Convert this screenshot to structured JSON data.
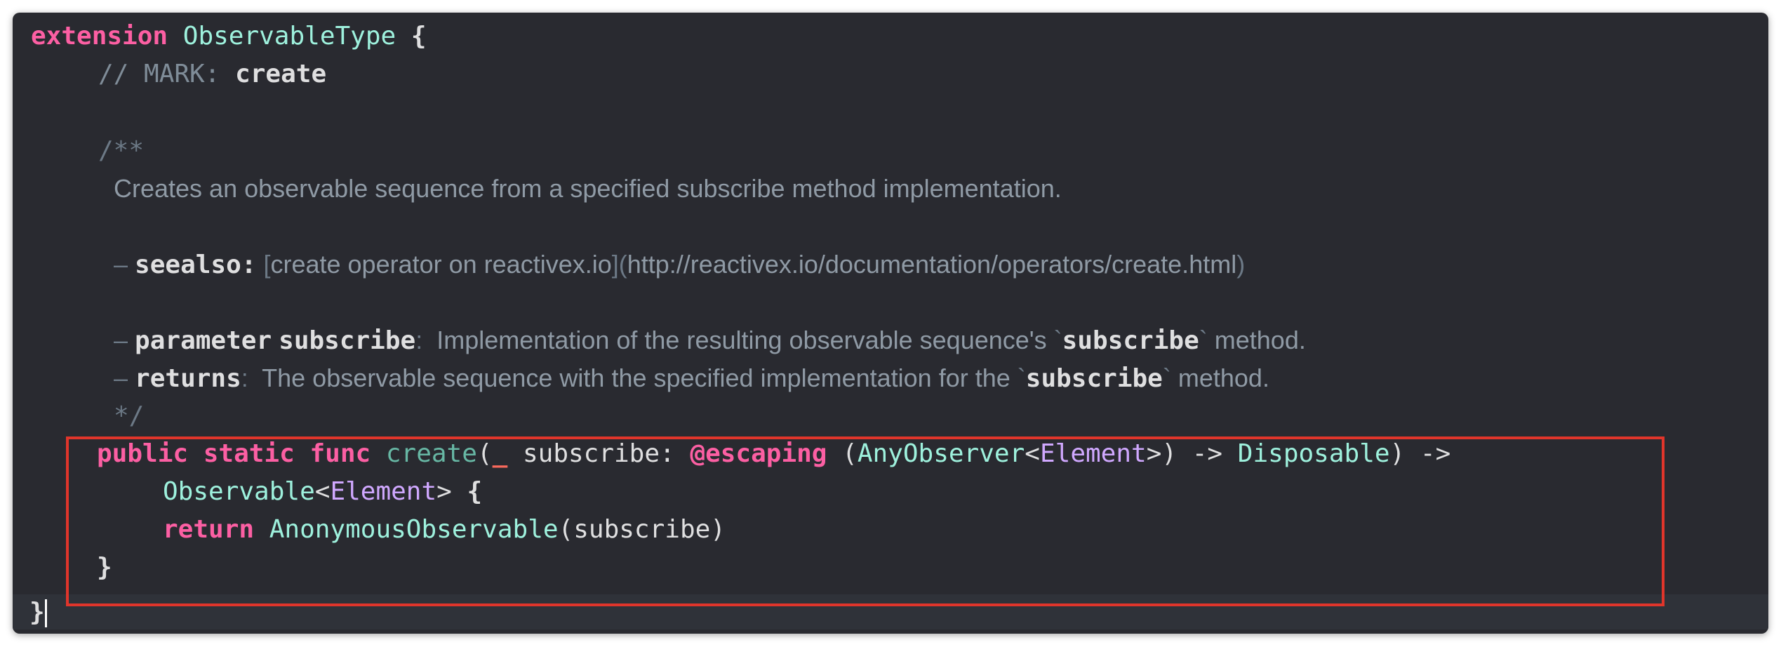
{
  "code": {
    "line1": {
      "keyword": "extension",
      "type": "ObservableType",
      "brace": "{"
    },
    "line2": {
      "prefix": "// MARK: ",
      "label": "create"
    },
    "line4": {
      "text": "/**"
    },
    "line5": {
      "text": "Creates an observable sequence from a specified subscribe method implementation."
    },
    "line7": {
      "dash": "–",
      "tag": "seealso:",
      "link_open": "[",
      "link_text": "create operator on reactivex.io",
      "link_close": "]",
      "url_open": "(",
      "url": "http://reactivex.io/documentation/operators/create.html",
      "url_close": ")"
    },
    "line9": {
      "dash": "–",
      "tag": "parameter",
      "param": "subscribe",
      "colon": ":",
      "text1": "Implementation of the resulting observable sequence's",
      "tick1": "`",
      "code": "subscribe",
      "tick2": "`",
      "text2": "method."
    },
    "line10": {
      "dash": "–",
      "tag": "returns",
      "colon": ":",
      "text1": "The observable sequence with the specified implementation for the",
      "tick1": "`",
      "code": "subscribe",
      "tick2": "`",
      "text2": "method."
    },
    "line11": {
      "text": "*/"
    },
    "line12": {
      "kw_public": "public",
      "kw_static": "static",
      "kw_func": "func",
      "fn_name": "create",
      "paren_open": "(",
      "underscore": "_",
      "param": "subscribe:",
      "attr": "@escaping",
      "paren2": "(",
      "type1": "AnyObserver",
      "lt": "<",
      "generic": "Element",
      "gt": ">",
      "paren3": ")",
      "arrow": "->",
      "type2": "Disposable",
      "paren4": ")",
      "arrow2": "->"
    },
    "line13": {
      "type": "Observable",
      "lt": "<",
      "generic": "Element",
      "gt": ">",
      "brace": "{"
    },
    "line14": {
      "kw": "return",
      "type": "AnonymousObservable",
      "args": "(subscribe)"
    },
    "line15": {
      "text": "}"
    },
    "line16": {
      "text": "}"
    }
  },
  "colors": {
    "background": "#292a30",
    "keyword": "#fc5fa3",
    "type": "#9ef1dd",
    "generic": "#d0a8ff",
    "function": "#67b7a4",
    "attribute": "#fc6a5d",
    "comment": "#7f8c98",
    "highlight_box": "#e0352b"
  }
}
